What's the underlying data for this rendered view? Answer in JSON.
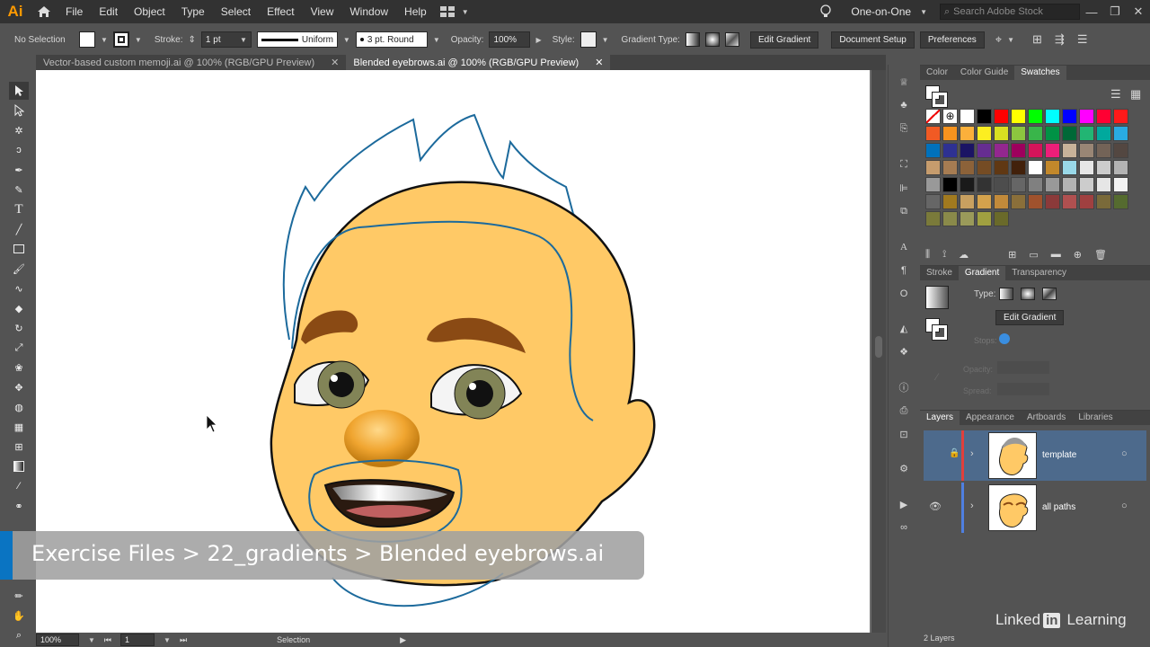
{
  "menubar": {
    "app_logo": "Ai",
    "items": [
      "File",
      "Edit",
      "Object",
      "Type",
      "Select",
      "Effect",
      "View",
      "Window",
      "Help"
    ],
    "workspace": "One-on-One",
    "search_placeholder": "Search Adobe Stock"
  },
  "controlbar": {
    "selection": "No Selection",
    "stroke_label": "Stroke:",
    "stroke_value": "1 pt",
    "profile": "Uniform",
    "brush": "3 pt. Round",
    "opacity_label": "Opacity:",
    "opacity_value": "100%",
    "style_label": "Style:",
    "gradient_type_label": "Gradient Type:",
    "edit_gradient": "Edit Gradient",
    "document_setup": "Document Setup",
    "preferences": "Preferences"
  },
  "tabs": [
    {
      "label": "Vector-based custom memoji.ai @ 100% (RGB/GPU Preview)",
      "active": false
    },
    {
      "label": "Blended eyebrows.ai @ 100% (RGB/GPU Preview)",
      "active": true
    }
  ],
  "statusbar": {
    "zoom": "100%",
    "artboard": "1",
    "tool": "Selection"
  },
  "color_panel": {
    "tabs": [
      "Color",
      "Color Guide",
      "Swatches"
    ],
    "active": "Swatches"
  },
  "gradient_panel": {
    "tabs": [
      "Stroke",
      "Gradient",
      "Transparency"
    ],
    "active": "Gradient",
    "type_label": "Type:",
    "edit_gradient": "Edit Gradient",
    "stops_label": "Stops:",
    "opacity_label": "Opacity:",
    "spread_label": "Spread:"
  },
  "layers_panel": {
    "tabs": [
      "Layers",
      "Appearance",
      "Artboards",
      "Libraries"
    ],
    "active": "Layers",
    "layers": [
      {
        "name": "template",
        "locked": true,
        "color": "#e0403c"
      },
      {
        "name": "all paths",
        "locked": false,
        "color": "#4f7fe0"
      }
    ],
    "footer": "2 Layers"
  },
  "caption": "Exercise Files > 22_gradients > Blended eyebrows.ai",
  "watermark": {
    "brand": "Linked",
    "in": "in",
    "suffix": "Learning"
  },
  "colors": {
    "face": "#ffc966",
    "brow": "#8a4a14",
    "outline_blue": "#1c6a9c",
    "accent_orange": "#ff9a00",
    "layer_selected": "#4d6a8c"
  }
}
